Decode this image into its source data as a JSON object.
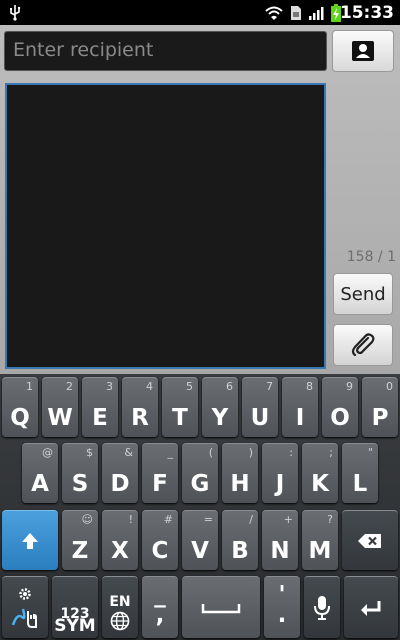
{
  "status_bar": {
    "time": "15:33",
    "icons": [
      "usb-icon",
      "wifi-icon",
      "sim-icon",
      "signal-icon",
      "battery-charging-icon"
    ],
    "battery_color": "#5fd41a"
  },
  "compose": {
    "recipient_placeholder": "Enter recipient",
    "counter": "158 / 1",
    "send_label": "Send",
    "focus_color": "#3a78b5"
  },
  "keyboard": {
    "row1": [
      {
        "main": "Q",
        "sub": "1"
      },
      {
        "main": "W",
        "sub": "2"
      },
      {
        "main": "E",
        "sub": "3"
      },
      {
        "main": "R",
        "sub": "4"
      },
      {
        "main": "T",
        "sub": "5"
      },
      {
        "main": "Y",
        "sub": "6"
      },
      {
        "main": "U",
        "sub": "7"
      },
      {
        "main": "I",
        "sub": "8"
      },
      {
        "main": "O",
        "sub": "9"
      },
      {
        "main": "P",
        "sub": "0"
      }
    ],
    "row2": [
      {
        "main": "A",
        "sub": "@"
      },
      {
        "main": "S",
        "sub": "$"
      },
      {
        "main": "D",
        "sub": "&"
      },
      {
        "main": "F",
        "sub": "_"
      },
      {
        "main": "G",
        "sub": "("
      },
      {
        "main": "H",
        "sub": ")"
      },
      {
        "main": "J",
        "sub": ":"
      },
      {
        "main": "K",
        "sub": ";"
      },
      {
        "main": "L",
        "sub": "\""
      }
    ],
    "row3": [
      {
        "main": "Z",
        "sub": "☺"
      },
      {
        "main": "X",
        "sub": "!"
      },
      {
        "main": "C",
        "sub": "#"
      },
      {
        "main": "V",
        "sub": "="
      },
      {
        "main": "B",
        "sub": "/"
      },
      {
        "main": "N",
        "sub": "+"
      },
      {
        "main": "M",
        "sub": "?"
      }
    ],
    "sym_top": "123",
    "sym_bottom": "SYM",
    "lang_label": "EN",
    "dash_top": "_",
    "dash_bottom": ",",
    "comma_top": "'",
    "comma_bottom": ".",
    "shift_color": "#2b7fc0"
  }
}
